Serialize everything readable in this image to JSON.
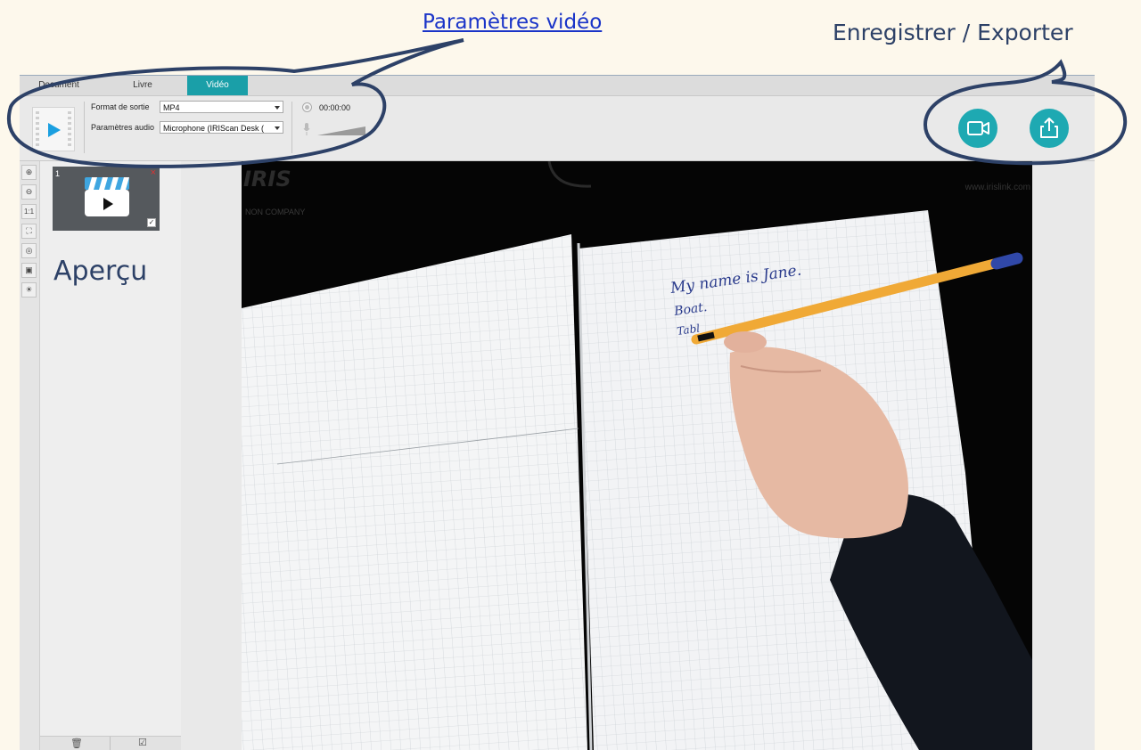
{
  "annotations": {
    "video_settings": "Paramètres vidéo",
    "record_export": "Enregistrer / Exporter",
    "preview": "Aperçu"
  },
  "tabs": [
    {
      "label": "Document",
      "active": false
    },
    {
      "label": "Livre",
      "active": false
    },
    {
      "label": "Vidéo",
      "active": true
    }
  ],
  "settings": {
    "output_format_label": "Format de sortie",
    "output_format_value": "MP4",
    "audio_label": "Paramètres audio",
    "audio_value": "Microphone (IRIScan Desk (",
    "timer": "00:00:00"
  },
  "thumbnail": {
    "index": "1",
    "checkmark": "✓",
    "remove": "×"
  },
  "watermark": {
    "logo": "IRIS",
    "tagline": "NON COMPANY",
    "url": "www.irislink.com"
  },
  "handwriting": {
    "line1": "My name is Jane.",
    "line2": "Boat.",
    "line3": "Tabl"
  },
  "colors": {
    "accent": "#1a9fa8",
    "annotation_ring": "#2d4167",
    "link": "#1a34c8",
    "background": "#fdf8ec"
  },
  "icons": {
    "record": "video-camera-icon",
    "export": "share-upload-icon",
    "zoom_in": "zoom-in-icon",
    "zoom_out": "zoom-out-icon",
    "actual_size": "1:1",
    "fit": "fit-screen-icon",
    "webcam": "webcam-icon",
    "crop": "crop-icon",
    "brightness": "brightness-icon",
    "delete": "trash-icon",
    "select_all": "select-all-icon"
  }
}
